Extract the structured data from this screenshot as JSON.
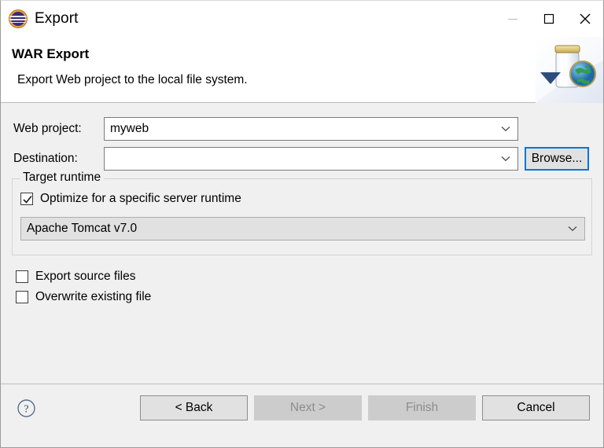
{
  "window": {
    "title": "Export",
    "icon": "eclipse-icon",
    "controls": {
      "minimize": "minimize-icon",
      "maximize": "maximize-icon",
      "close": "close-icon"
    }
  },
  "header": {
    "title": "WAR Export",
    "description": "Export Web project to the local file system.",
    "banner_icon": "war-jar-globe-icon"
  },
  "form": {
    "web_project": {
      "label": "Web project:",
      "value": "myweb",
      "placeholder": ""
    },
    "destination": {
      "label": "Destination:",
      "value": "",
      "placeholder": ""
    },
    "browse_button": "Browse..."
  },
  "target_runtime": {
    "group_label": "Target runtime",
    "optimize_checkbox": {
      "label": "Optimize for a specific server runtime",
      "checked": true
    },
    "runtime_select": {
      "value": "Apache Tomcat v7.0",
      "enabled": false
    }
  },
  "options": [
    {
      "label": "Export source files",
      "checked": false
    },
    {
      "label": "Overwrite existing file",
      "checked": false
    }
  ],
  "footer": {
    "help_icon": "help-question-icon",
    "buttons": [
      {
        "label": "< Back",
        "enabled": true
      },
      {
        "label": "Next >",
        "enabled": false
      },
      {
        "label": "Finish",
        "enabled": false
      },
      {
        "label": "Cancel",
        "enabled": true
      }
    ]
  },
  "colors": {
    "dialog_bg": "#f0f0f0",
    "header_bg": "#ffffff",
    "focus_blue": "#0078d7",
    "disabled_gray": "#cccccc",
    "field_border": "#7a7a7a"
  }
}
